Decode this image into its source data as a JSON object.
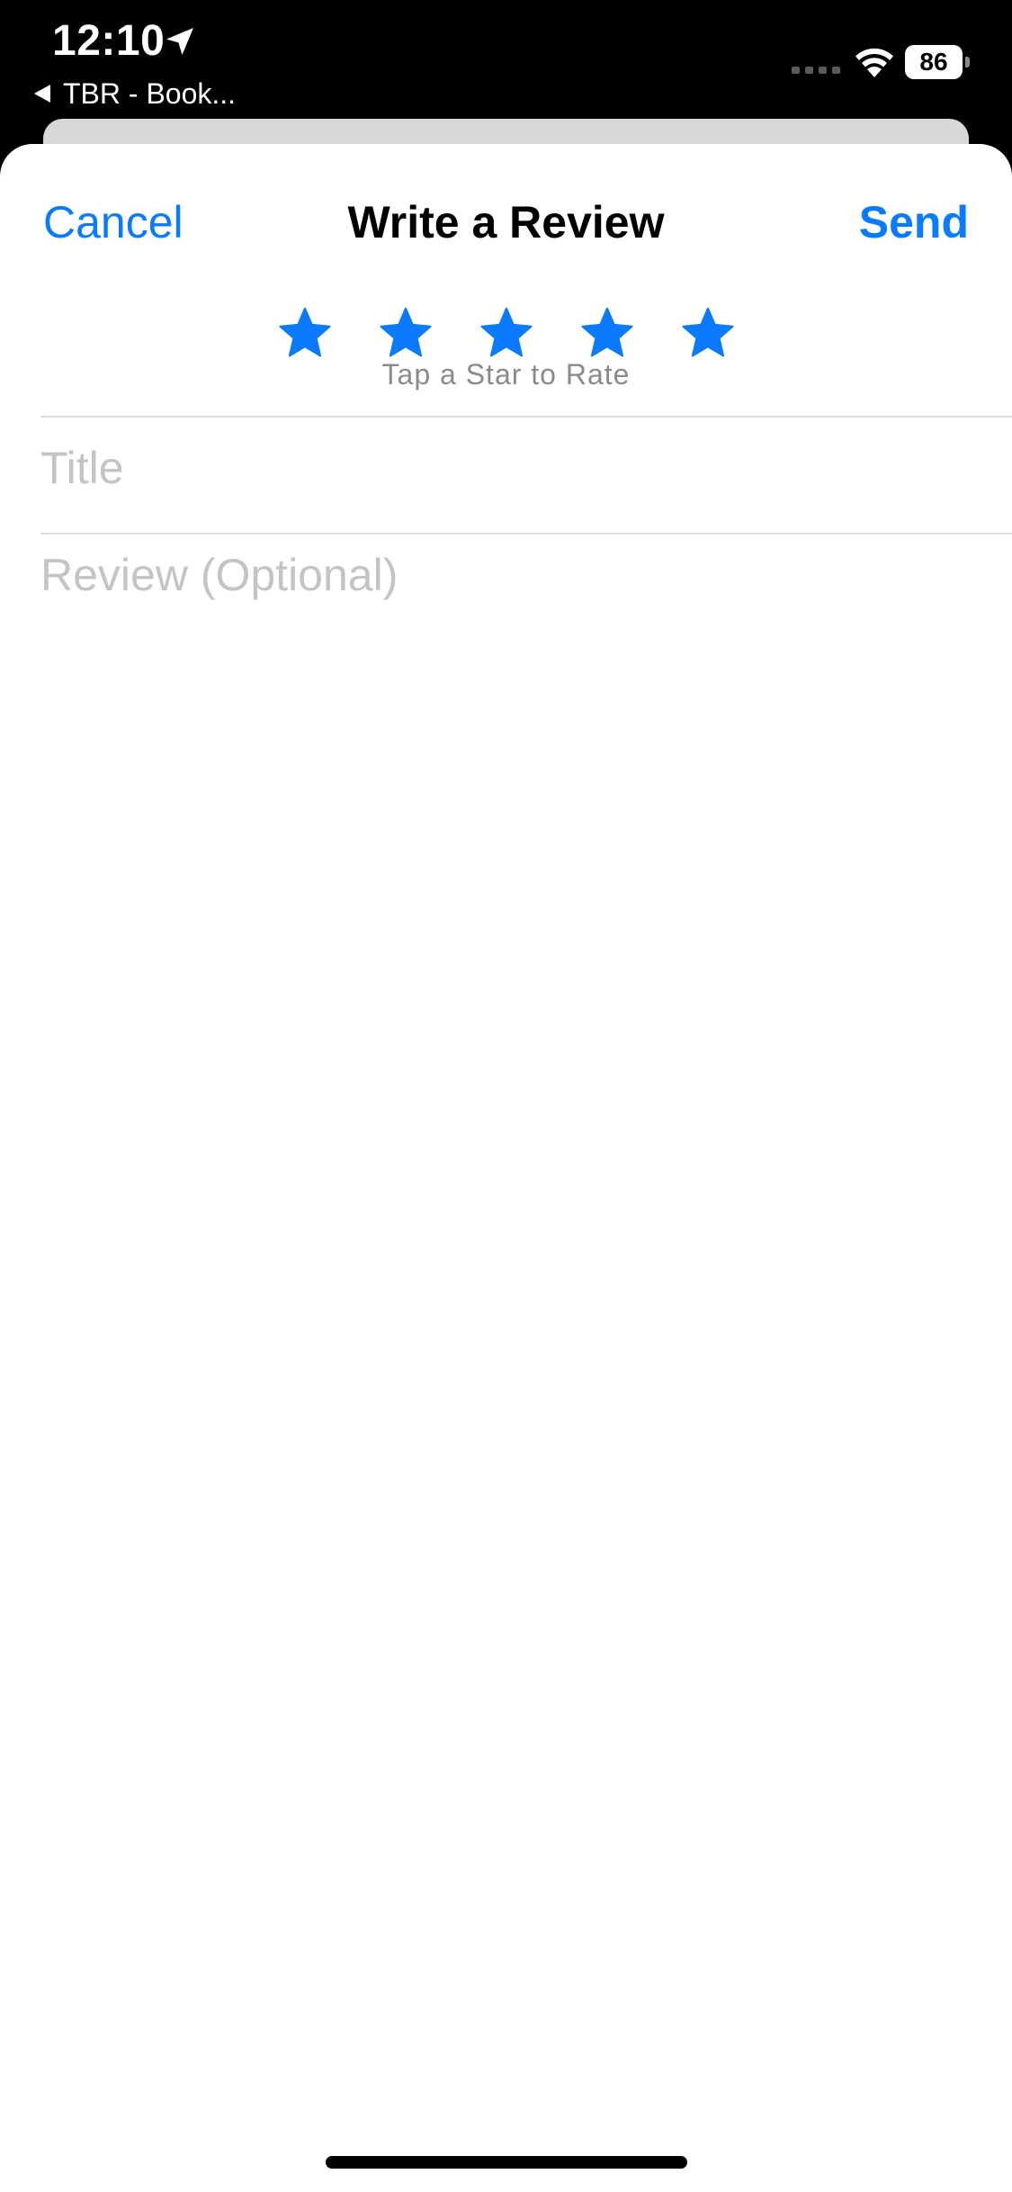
{
  "status_bar": {
    "time": "12:10",
    "back_app_label": "TBR - Book...",
    "battery_level": "86",
    "icons": [
      "location-arrow-icon",
      "cellular-icon",
      "wifi-icon",
      "battery-icon"
    ]
  },
  "nav": {
    "cancel_label": "Cancel",
    "title": "Write a Review",
    "send_label": "Send"
  },
  "rating": {
    "star_count": 5,
    "hint": "Tap a Star to Rate",
    "star_icon": "star-icon"
  },
  "form": {
    "title_placeholder": "Title",
    "review_placeholder": "Review (Optional)"
  },
  "colors": {
    "accent": "#0a7aff",
    "placeholder": "#c4c4c6",
    "hint": "#8a8a8e",
    "status_bar_bg": "#000000"
  }
}
